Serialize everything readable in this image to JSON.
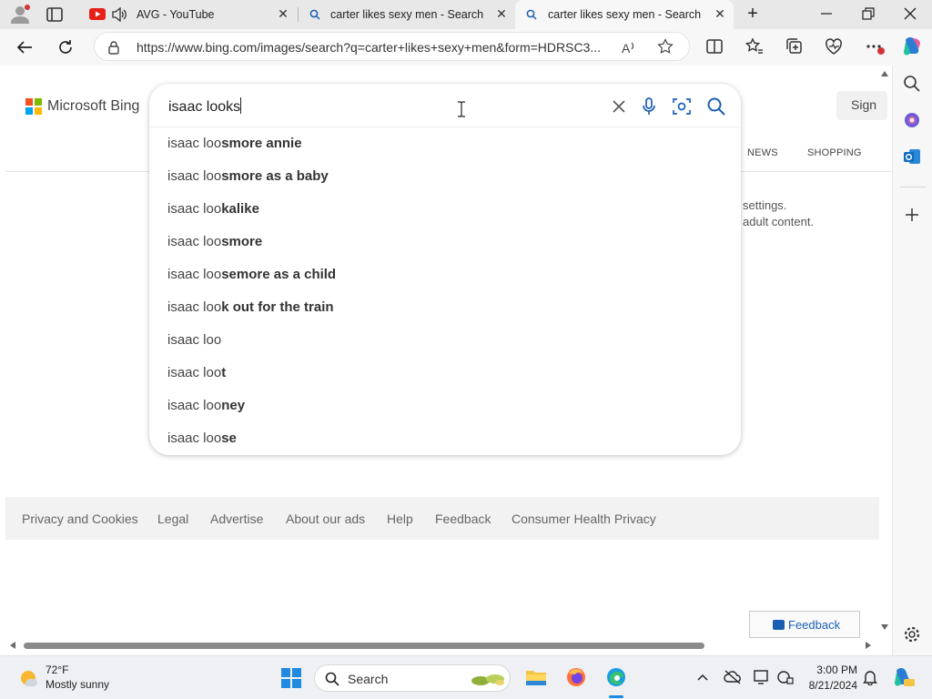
{
  "browser": {
    "tabs": [
      {
        "title": "AVG - YouTube"
      },
      {
        "title": "carter likes sexy men - Search"
      },
      {
        "title": "carter likes sexy men - Search Im"
      }
    ],
    "url": "https://www.bing.com/images/search?q=carter+likes+sexy+men&form=HDRSC3...",
    "tab_close_glyph": "✕",
    "new_tab_glyph": "+"
  },
  "bing": {
    "logo_text": "Microsoft Bing",
    "sign_in": "Sign",
    "nav": {
      "news": "NEWS",
      "shopping": "SHOPPING"
    },
    "message_line1": "settings.",
    "message_line2": "adult content.",
    "search_query": "isaac looks",
    "suggestions": [
      {
        "prefix": "isaac loo",
        "bold": "smore annie"
      },
      {
        "prefix": "isaac loo",
        "bold": "smore as a baby"
      },
      {
        "prefix": "isaac loo",
        "bold": "kalike"
      },
      {
        "prefix": "isaac loo",
        "bold": "smore"
      },
      {
        "prefix": "isaac loo",
        "bold": "semore as a child"
      },
      {
        "prefix": "isaac loo",
        "bold": "k out for the train"
      },
      {
        "prefix": "isaac loo",
        "bold": ""
      },
      {
        "prefix": "isaac loo",
        "bold": "t"
      },
      {
        "prefix": "isaac loo",
        "bold": "ney"
      },
      {
        "prefix": "isaac loo",
        "bold": "se"
      }
    ],
    "footer_links": [
      "Privacy and Cookies",
      "Legal",
      "Advertise",
      "About our ads",
      "Help",
      "Feedback",
      "Consumer Health Privacy"
    ],
    "feedback_button": "Feedback"
  },
  "taskbar": {
    "weather_temp": "72°F",
    "weather_cond": "Mostly sunny",
    "search_label": "Search",
    "time": "3:00 PM",
    "date": "8/21/2024"
  },
  "colors": {
    "bing_blue": "#1a5fb4",
    "ms_red": "#f25022",
    "ms_green": "#7fba00",
    "ms_blue": "#00a4ef",
    "ms_yellow": "#ffb900"
  }
}
